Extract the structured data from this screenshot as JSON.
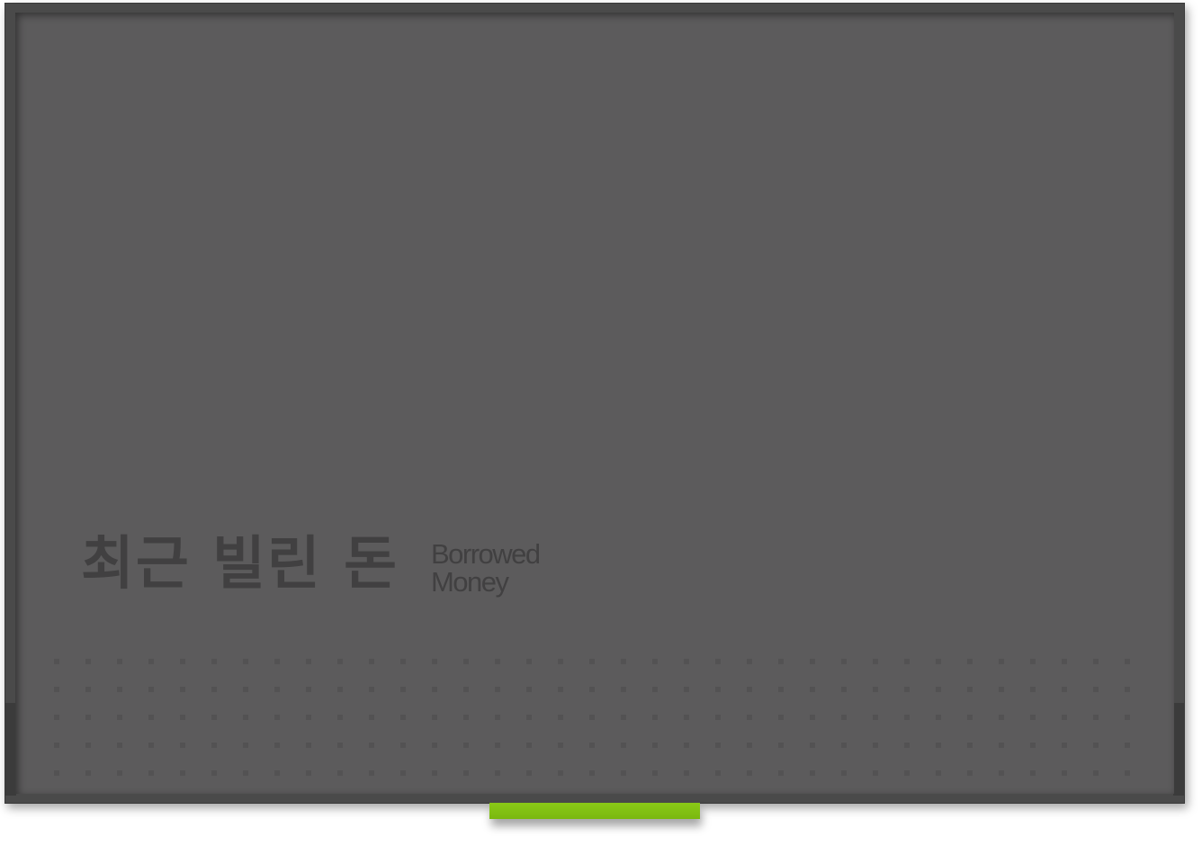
{
  "panel": {
    "title_korean": "최근 빌린 돈",
    "title_english_line1": "Borrowed",
    "title_english_line2": "Money"
  },
  "colors": {
    "frame": "#4a4a4a",
    "screen": "#5c5b5c",
    "text": "#414041",
    "dots": "#535253",
    "accent_tab": "#8ac917"
  },
  "dot_grid": {
    "rows": 5,
    "columns": 35
  }
}
